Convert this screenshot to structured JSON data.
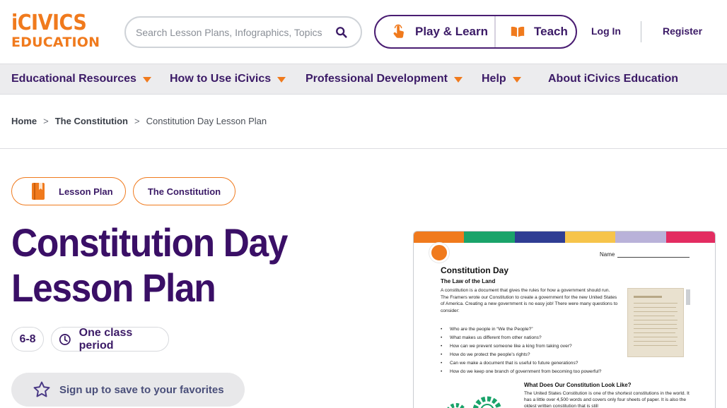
{
  "header": {
    "logo_line1": "iCIVICS",
    "logo_line2": "EDUCATION",
    "search_placeholder": "Search Lesson Plans, Infographics, Topics",
    "modes": [
      {
        "label": "Play & Learn",
        "icon": "hand-pointer-icon"
      },
      {
        "label": "Teach",
        "icon": "open-book-icon"
      }
    ],
    "login": "Log In",
    "register": "Register"
  },
  "nav": [
    {
      "label": "Educational Resources",
      "dropdown": true
    },
    {
      "label": "How to Use iCivics",
      "dropdown": true
    },
    {
      "label": "Professional Development",
      "dropdown": true
    },
    {
      "label": "Help",
      "dropdown": true
    },
    {
      "label": "About iCivics Education",
      "dropdown": false
    }
  ],
  "breadcrumb": {
    "items": [
      "Home",
      "The Constitution"
    ],
    "separator": ">",
    "current": "Constitution Day Lesson Plan"
  },
  "tags": {
    "type": "Lesson Plan",
    "topic": "The Constitution"
  },
  "page": {
    "title_line1": "Constitution Day",
    "title_line2": "Lesson Plan",
    "grade": "6-8",
    "duration": "One class period",
    "favorites": "Sign up to save to your favorites"
  },
  "preview": {
    "name_label": "Name",
    "title": "Constitution Day",
    "subtitle": "The Law of the Land",
    "intro": "A constitution is a document that gives the rules for how a government should run. The Framers wrote our Constitution to create a government for the new United States of America. Creating a new government is no easy job! There were many questions to consider:",
    "questions": [
      "Who are the people in “We the People?”",
      "What makes us different from other nations?",
      "How can we prevent someone like a king from taking over?",
      "How do we protect the people’s rights?",
      "Can we make a document that is useful to future generations?",
      "How do we keep one branch of government from becoming too powerful?"
    ],
    "section2_title": "What Does Our Constitution Look Like?",
    "section2_text": "The United States Constitution is one of the shortest constitutions in the world. It has a little over 4,500 words and covers only four sheets of paper. It is also the oldest written constitution that is still",
    "band_colors": [
      "#f07a1d",
      "#1aa36a",
      "#2f3d93",
      "#f6c44b",
      "#b9b2d9",
      "#e32c61"
    ]
  },
  "colors": {
    "brand_orange": "#f07a1d",
    "brand_purple": "#3a0f66"
  }
}
